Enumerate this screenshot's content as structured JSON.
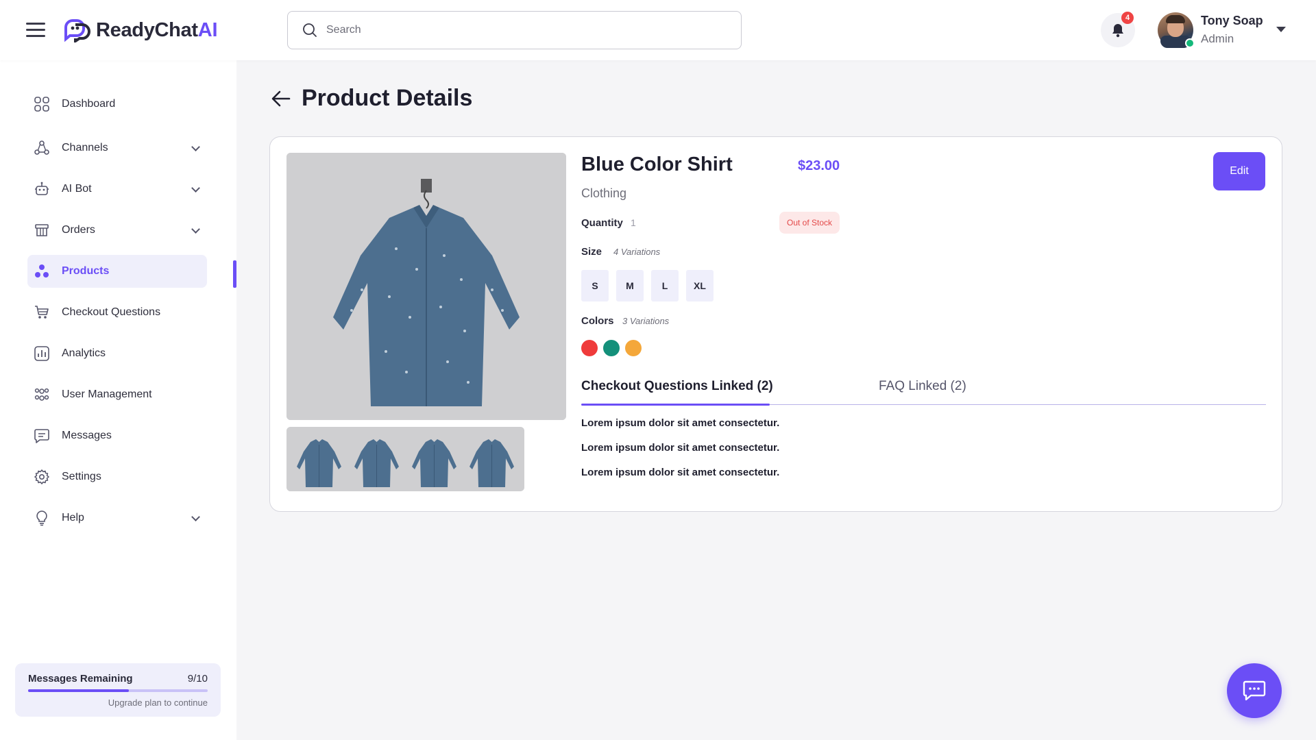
{
  "app": {
    "brand_prefix": "ReadyChat",
    "brand_suffix": "AI"
  },
  "header": {
    "search_placeholder": "Search",
    "notifications_count": "4",
    "user_name": "Tony Soap",
    "user_role": "Admin"
  },
  "sidebar": {
    "items": [
      {
        "label": "Dashboard",
        "icon": "grid-icon"
      },
      {
        "label": "Channels",
        "icon": "channels-icon",
        "has_submenu": true
      },
      {
        "label": "AI Bot",
        "icon": "robot-icon",
        "has_submenu": true
      },
      {
        "label": "Orders",
        "icon": "orders-icon",
        "has_submenu": true
      },
      {
        "label": "Products",
        "icon": "products-icon",
        "active": true
      },
      {
        "label": "Checkout Questions",
        "icon": "cart-icon"
      },
      {
        "label": "Analytics",
        "icon": "analytics-icon"
      },
      {
        "label": "User Management",
        "icon": "users-icon"
      },
      {
        "label": "Messages",
        "icon": "message-icon"
      },
      {
        "label": "Settings",
        "icon": "gear-icon"
      },
      {
        "label": "Help",
        "icon": "lightbulb-icon",
        "has_submenu": true
      }
    ],
    "quota": {
      "label": "Messages Remaining",
      "count": "9/10",
      "progress": 0.56,
      "hint": "Upgrade plan to continue"
    }
  },
  "page": {
    "title": "Product Details"
  },
  "product": {
    "name": "Blue Color Shirt",
    "price": "$23.00",
    "category": "Clothing",
    "quantity_label": "Quantity",
    "quantity_value": "1",
    "stock_status": "Out of Stock",
    "size_label": "Size",
    "size_variations": "4 Variations",
    "sizes": [
      "S",
      "M",
      "L",
      "XL"
    ],
    "colors_label": "Colors",
    "colors_variations": "3 Variations",
    "colors": [
      "#ef3b3b",
      "#14907a",
      "#f4a73a"
    ],
    "edit_label": "Edit"
  },
  "tabs": {
    "checkout": "Checkout Questions Linked (2)",
    "faq": "FAQ Linked (2)"
  },
  "linked_items": [
    "Lorem ipsum dolor sit amet consectetur.",
    "Lorem ipsum dolor sit amet consectetur.",
    "Lorem ipsum dolor sit amet consectetur."
  ],
  "theme": {
    "accent": "#6b4ef6",
    "danger": "#e34848",
    "success": "#14b87a"
  }
}
